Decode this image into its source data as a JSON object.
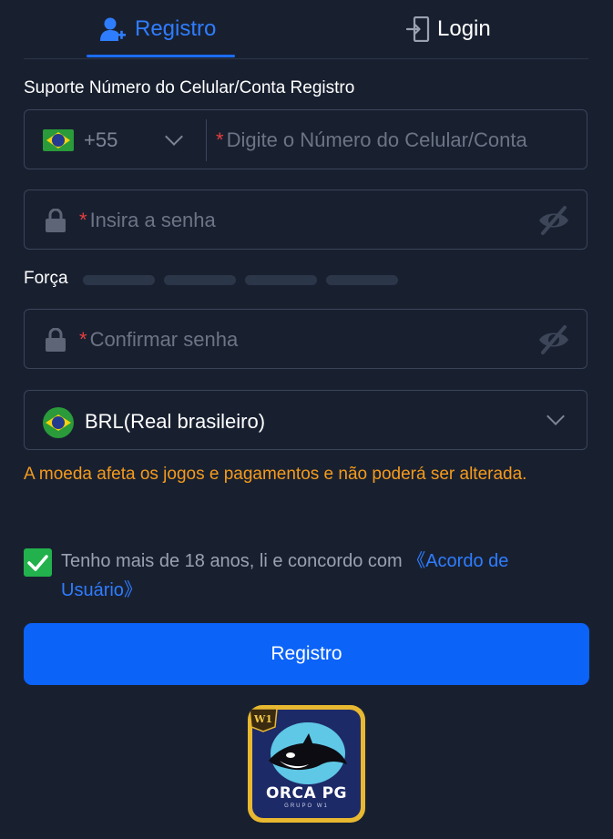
{
  "tabs": {
    "register": "Registro",
    "login": "Login"
  },
  "phone_section": {
    "label": "Suporte Número do Celular/Conta Registro",
    "country_code": "+55",
    "placeholder_star": "*",
    "placeholder": "Digite o Número do Celular/Conta"
  },
  "password": {
    "placeholder_star": "*",
    "placeholder": "Insira a senha"
  },
  "strength": {
    "label": "Força",
    "bars_filled": 0,
    "bars_total": 4
  },
  "confirm": {
    "placeholder_star": "*",
    "placeholder": "Confirmar senha"
  },
  "currency": {
    "selected": "BRL(Real brasileiro)"
  },
  "warning": "A moeda afeta os jogos e pagamentos e não poderá ser alterada.",
  "agreement": {
    "checked": true,
    "text": "Tenho mais de 18 anos, li e concordo com ",
    "link": "《Acordo de Usuário》"
  },
  "submit_label": "Registro",
  "logo": {
    "name": "ORCA PG",
    "sub": "GRUPO W1",
    "badge": "W1"
  },
  "colors": {
    "accent": "#0b63f8",
    "warning": "#f59a1b",
    "check": "#22b14c",
    "background": "#182030"
  }
}
